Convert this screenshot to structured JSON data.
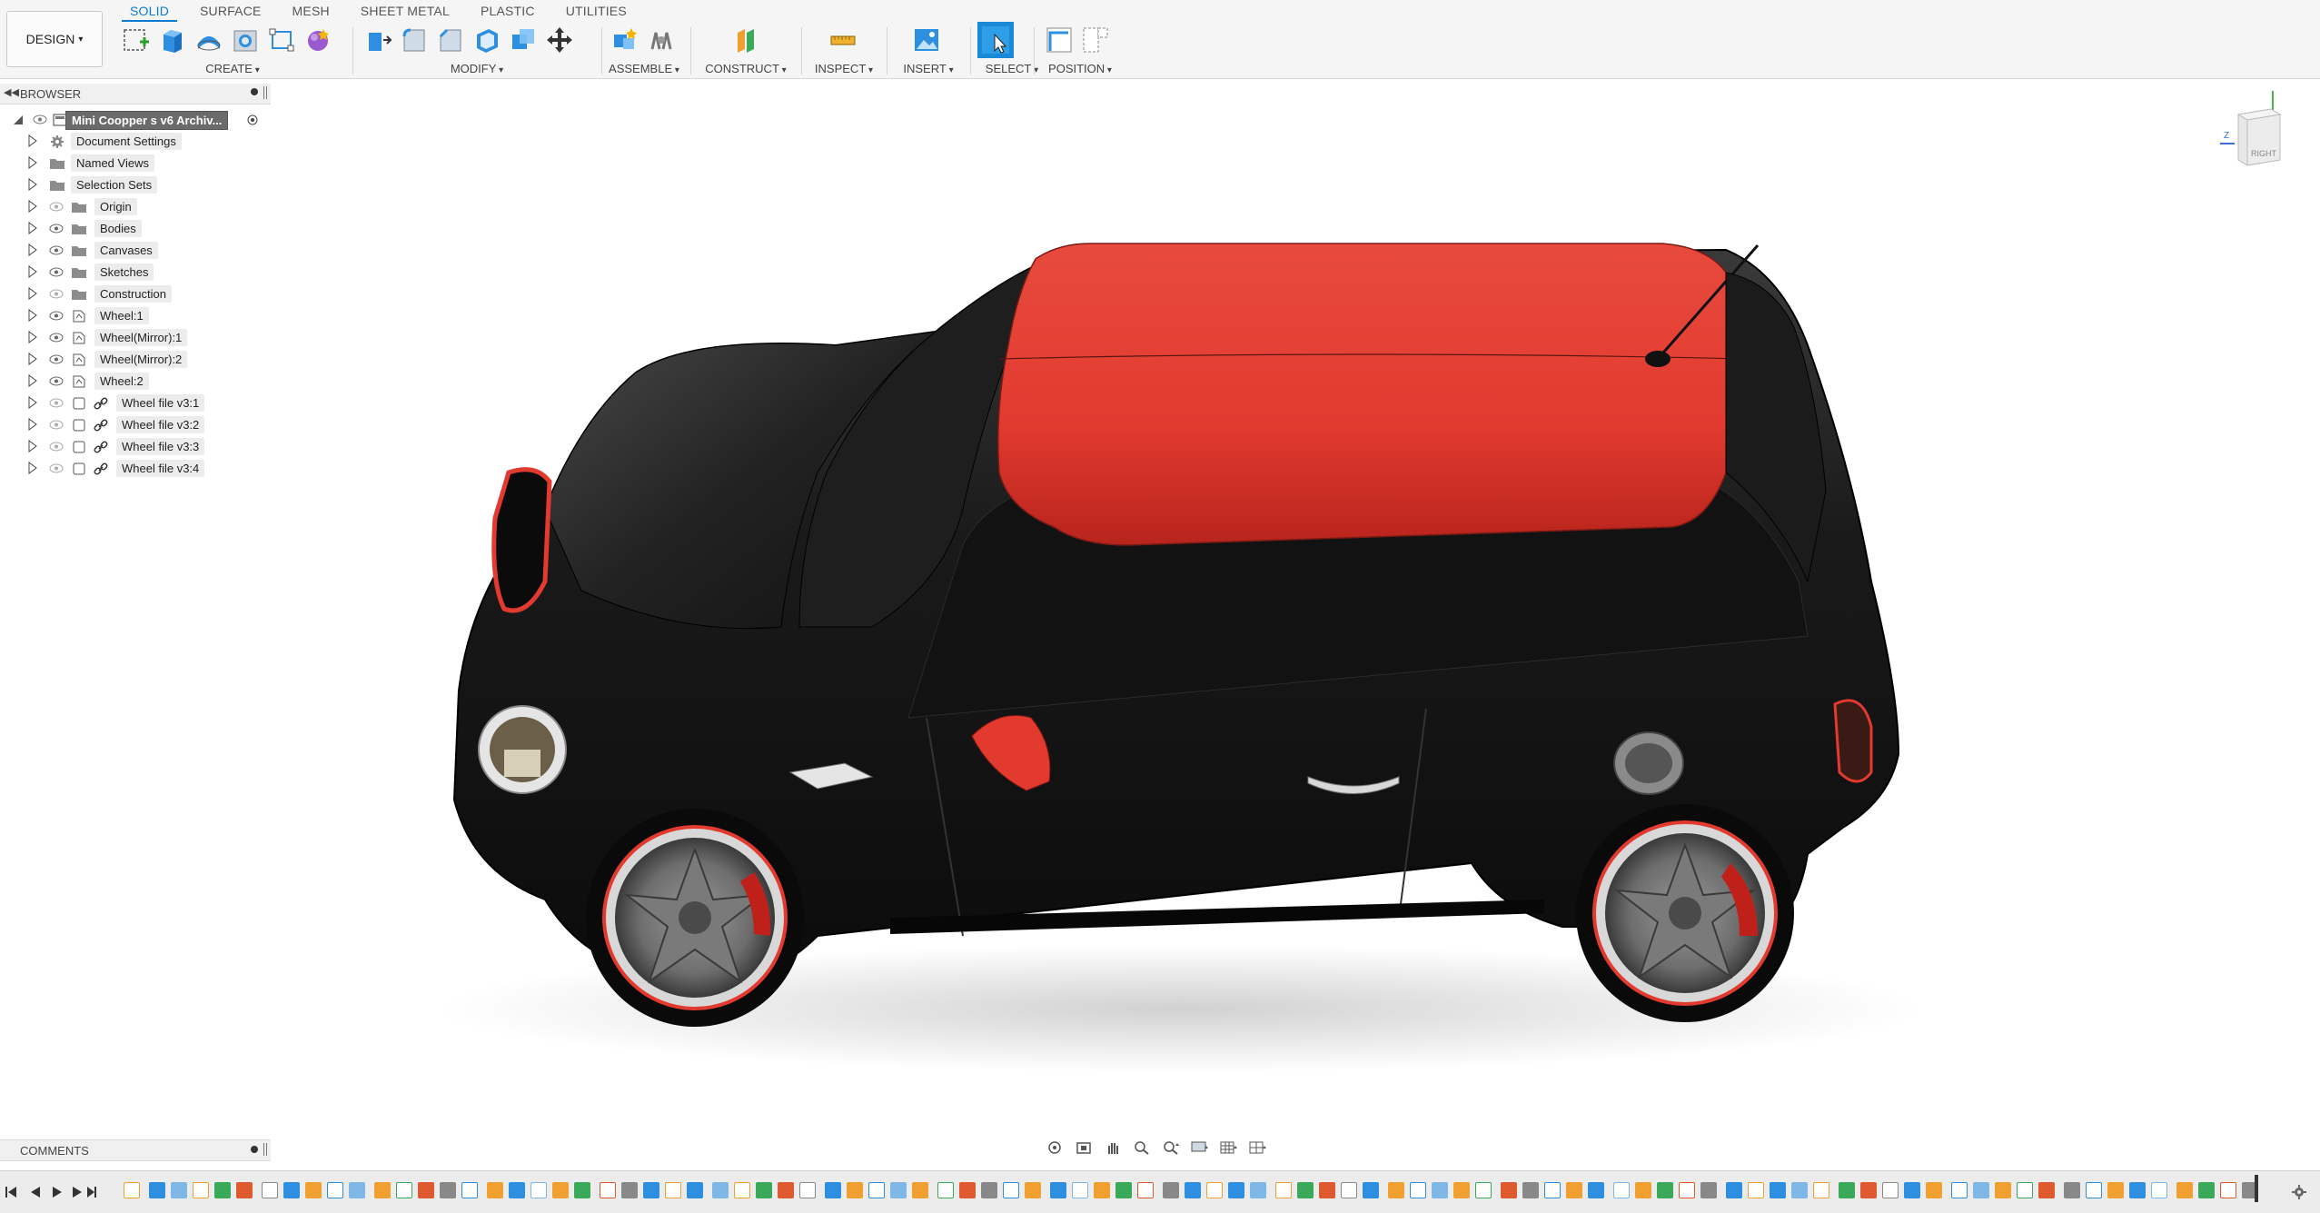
{
  "toolbar": {
    "workspace_button": "DESIGN",
    "tabs": [
      "SOLID",
      "SURFACE",
      "MESH",
      "SHEET METAL",
      "PLASTIC",
      "UTILITIES"
    ],
    "active_tab": "SOLID",
    "groups": {
      "create": "CREATE",
      "modify": "MODIFY",
      "assemble": "ASSEMBLE",
      "construct": "CONSTRUCT",
      "inspect": "INSPECT",
      "insert": "INSERT",
      "select": "SELECT",
      "position": "POSITION"
    }
  },
  "browser": {
    "title": "BROWSER",
    "root": "Mini Coopper s v6 Archiv...",
    "items": [
      {
        "label": "Document Settings",
        "icon": "gear-icon"
      },
      {
        "label": "Named Views",
        "icon": "folder-icon"
      },
      {
        "label": "Selection Sets",
        "icon": "folder-icon"
      },
      {
        "label": "Origin",
        "icon": "folder-icon"
      },
      {
        "label": "Bodies",
        "icon": "folder-icon"
      },
      {
        "label": "Canvases",
        "icon": "folder-icon"
      },
      {
        "label": "Sketches",
        "icon": "folder-icon"
      },
      {
        "label": "Construction",
        "icon": "folder-icon"
      },
      {
        "label": "Wheel:1",
        "icon": "component-icon"
      },
      {
        "label": "Wheel(Mirror):1",
        "icon": "component-icon"
      },
      {
        "label": "Wheel(Mirror):2",
        "icon": "component-icon"
      },
      {
        "label": "Wheel:2",
        "icon": "component-icon"
      },
      {
        "label": "Wheel file v3:1",
        "icon": "link-icon"
      },
      {
        "label": "Wheel file v3:2",
        "icon": "link-icon"
      },
      {
        "label": "Wheel file v3:3",
        "icon": "link-icon"
      },
      {
        "label": "Wheel file v3:4",
        "icon": "link-icon"
      }
    ]
  },
  "comments": {
    "title": "COMMENTS"
  },
  "viewcube": {
    "face_label": "RIGHT",
    "axis_label": "Z"
  },
  "colors": {
    "accent": "#0a7bd3",
    "car_body": "#161616",
    "car_roof": "#e43a30"
  }
}
